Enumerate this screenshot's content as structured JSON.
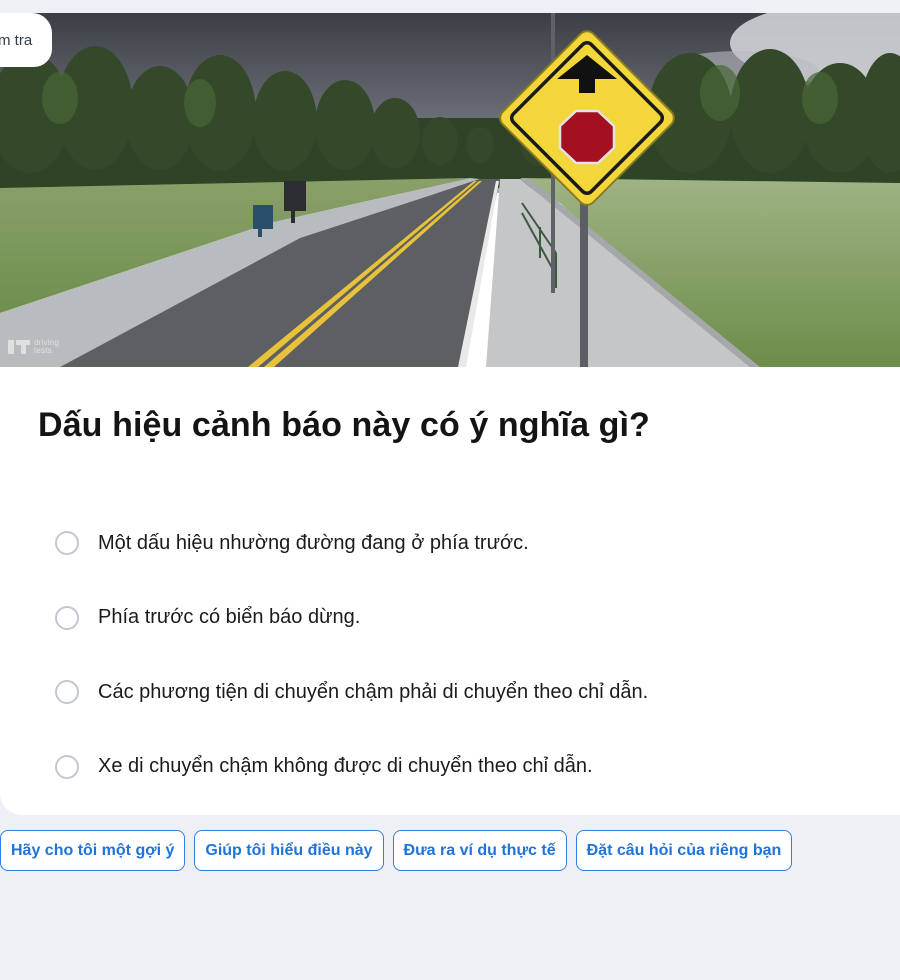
{
  "header": {
    "tab_label": "m tra"
  },
  "image": {
    "watermark_line1": "driving",
    "watermark_line2": "tests"
  },
  "question": {
    "text": "Dấu hiệu cảnh báo này có ý nghĩa gì?"
  },
  "options": [
    {
      "label": "Một dấu hiệu nhường đường đang ở phía trước."
    },
    {
      "label": "Phía trước có biển báo dừng."
    },
    {
      "label": "Các phương tiện di chuyển chậm phải di chuyển theo chỉ dẫn."
    },
    {
      "label": "Xe di chuyển chậm không được di chuyển theo chỉ dẫn."
    }
  ],
  "suggestions": [
    {
      "label": "Hãy cho tôi một gợi ý"
    },
    {
      "label": "Giúp tôi hiểu điều này"
    },
    {
      "label": "Đưa ra ví dụ thực tế"
    },
    {
      "label": "Đặt câu hỏi của riêng bạn"
    }
  ],
  "colors": {
    "page_background": "#eff0f6",
    "accent_blue": "#2f7fe0",
    "sign_yellow": "#f3d63a",
    "stop_red": "#a3101f"
  },
  "icons": {
    "sign": "stop-ahead-warning-sign",
    "watermark": "drivingtests-logo"
  }
}
